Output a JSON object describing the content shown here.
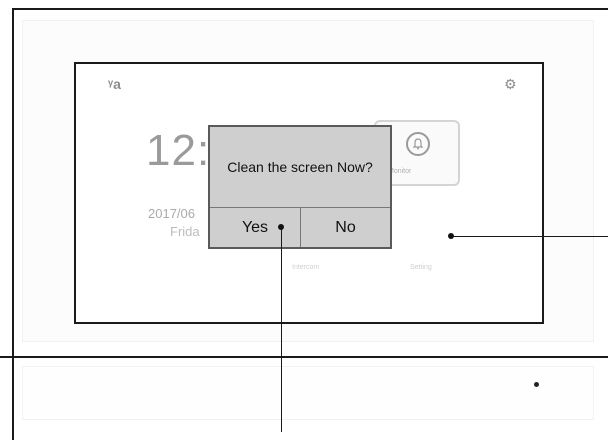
{
  "home": {
    "clock": "12:0",
    "date": "2017/06",
    "day": "Frida",
    "card_label": "Monitor",
    "label_left": "Intercom",
    "label_right": "Setting"
  },
  "dialog": {
    "message": "Clean the screen Now?",
    "yes_label": "Yes",
    "no_label": "No"
  }
}
